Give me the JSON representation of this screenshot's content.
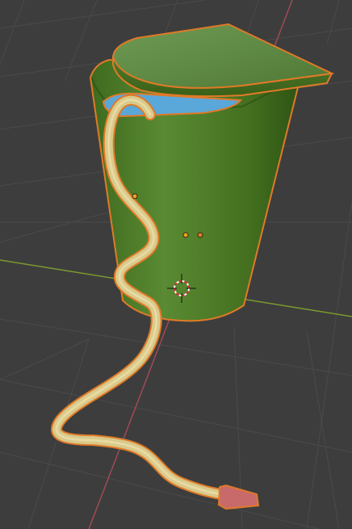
{
  "viewport": {
    "background_color": "#3d3d3d",
    "grid_color": "#4a4a4a",
    "x_axis_color": "#7a9a2e",
    "y_axis_color": "#a04a55"
  },
  "scene": {
    "objects": [
      {
        "name": "cup",
        "color": "#4e7a2a",
        "selected": true
      },
      {
        "name": "lid",
        "color": "#5f8a45",
        "selected": true
      },
      {
        "name": "water",
        "color": "#5aa7d9",
        "selected": true
      },
      {
        "name": "straw",
        "color": "#d9c98a",
        "selected": true
      },
      {
        "name": "straw-tip",
        "color": "#c86a6a",
        "selected": true
      }
    ],
    "selection_outline_color": "#e07a28",
    "origin_point_color": "#f0a020",
    "cursor": "3d-cursor-icon"
  }
}
